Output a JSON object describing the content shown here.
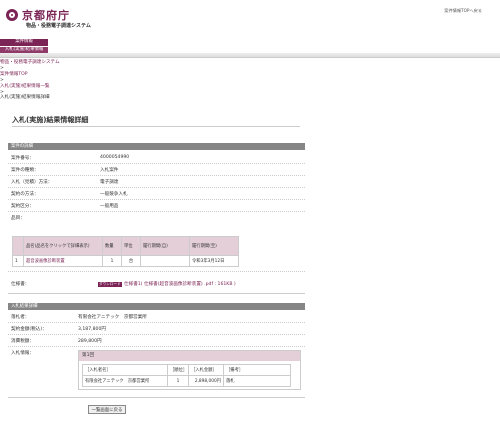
{
  "header": {
    "logo_text": "京都府庁",
    "system_name": "物品・役務電子調達システム",
    "top_link": "案件情報TOPへ戻る"
  },
  "menu": [
    "案件情報",
    "入札(実施)結果情報"
  ],
  "breadcrumb": [
    "物品・役務電子調達システム",
    ">",
    "案件情報TOP",
    ">",
    "入札(実施)結果情報一覧",
    ">",
    "入札(実施)結果情報詳細"
  ],
  "page_title": "入札(実施)結果情報詳細",
  "case_section": {
    "heading": "案件の詳細",
    "rows": [
      {
        "label": "案件番号：",
        "value": "4000054990"
      },
      {
        "label": "案件の種類：",
        "value": "入札案件"
      },
      {
        "label": "入札（見積）方法：",
        "value": "電子調達"
      },
      {
        "label": "契約の方法：",
        "value": "一般競争入札"
      },
      {
        "label": "契約区分：",
        "value": "一般用品"
      },
      {
        "label": "品目：",
        "value": ""
      }
    ]
  },
  "items_table": {
    "headers": [
      "",
      "品名(品名をクリックで詳細表示)",
      "数量",
      "単位",
      "履行期間(自)",
      "履行期間(至)"
    ],
    "rows": [
      [
        "1",
        "超音波画像診断装置",
        "1",
        "台",
        "",
        "令和3年3月12日"
      ]
    ]
  },
  "attachment": {
    "label": "仕様書：",
    "icon_text": "ダウンロード",
    "link_text": "仕様書1( 仕様書(超音波画像診断装置) .pdf : 161KB )"
  },
  "result_section": {
    "heading": "入札結果詳細",
    "rows": [
      {
        "label": "落札者：",
        "value": "有限会社アニテック　京都営業所"
      },
      {
        "label": "契約金額(税込)：",
        "value": "3,187,800円"
      },
      {
        "label": "消費税額：",
        "value": "289,800円"
      },
      {
        "label": "入札情報：",
        "value": ""
      }
    ]
  },
  "bid_info": {
    "round": "第1回",
    "headers": [
      "［入札者名］",
      "［順位］",
      "［入札金額］",
      "［備考］"
    ],
    "rows": [
      [
        "有限会社アニテック　京都営業所",
        "1",
        "2,898,000円",
        "落札"
      ]
    ]
  },
  "back_button": "一覧画面に戻る"
}
